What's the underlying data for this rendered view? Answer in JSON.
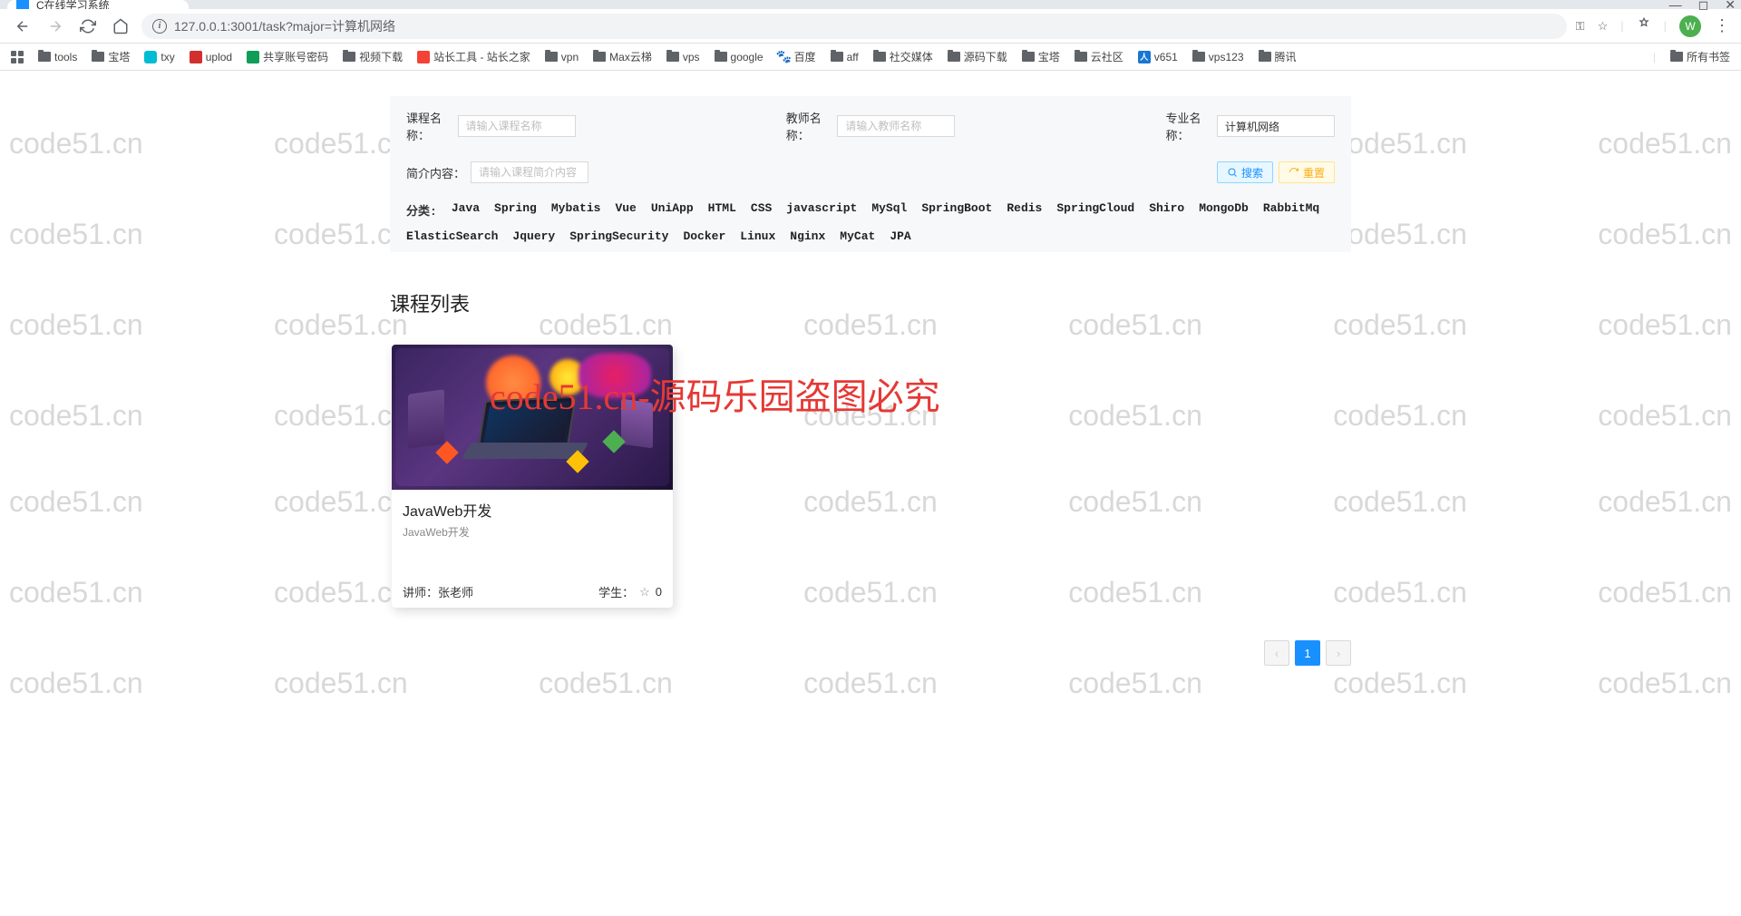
{
  "window": {
    "tab_title": "C在线学习系统"
  },
  "url_bar": {
    "url": "127.0.0.1:3001/task?major=计算机网络"
  },
  "avatar_letter": "W",
  "bookmarks": {
    "items": [
      {
        "label": "tools",
        "icon": "folder"
      },
      {
        "label": "宝塔",
        "icon": "folder"
      },
      {
        "label": "txy",
        "icon": "txy"
      },
      {
        "label": "uplod",
        "icon": "uplod"
      },
      {
        "label": "共享账号密码",
        "icon": "sheets"
      },
      {
        "label": "视频下载",
        "icon": "folder"
      },
      {
        "label": "站长工具 - 站长之家",
        "icon": "zz"
      },
      {
        "label": "vpn",
        "icon": "folder"
      },
      {
        "label": "Max云梯",
        "icon": "folder"
      },
      {
        "label": "vps",
        "icon": "folder"
      },
      {
        "label": "google",
        "icon": "folder"
      },
      {
        "label": "百度",
        "icon": "baidu"
      },
      {
        "label": "aff",
        "icon": "folder"
      },
      {
        "label": "社交媒体",
        "icon": "folder"
      },
      {
        "label": "源码下载",
        "icon": "folder"
      },
      {
        "label": "宝塔",
        "icon": "folder"
      },
      {
        "label": "云社区",
        "icon": "folder"
      },
      {
        "label": "v651",
        "icon": "v651"
      },
      {
        "label": "vps123",
        "icon": "folder"
      },
      {
        "label": "腾讯",
        "icon": "folder"
      }
    ],
    "all_bookmarks": "所有书签"
  },
  "search": {
    "course_label": "课程名称：",
    "course_placeholder": "请输入课程名称",
    "teacher_label": "教师名称：",
    "teacher_placeholder": "请输入教师名称",
    "major_label": "专业名称：",
    "major_value": "计算机网络",
    "intro_label": "简介内容：",
    "intro_placeholder": "请输入课程简介内容",
    "btn_search": "搜索",
    "btn_reset": "重置"
  },
  "categories": {
    "label": "分类:",
    "items": [
      "Java",
      "Spring",
      "Mybatis",
      "Vue",
      "UniApp",
      "HTML",
      "CSS",
      "javascript",
      "MySql",
      "SpringBoot",
      "Redis",
      "SpringCloud",
      "Shiro",
      "MongoDb",
      "RabbitMq",
      "ElasticSearch",
      "Jquery",
      "SpringSecurity",
      "Docker",
      "Linux",
      "Nginx",
      "MyCat",
      "JPA"
    ]
  },
  "list_title": "课程列表",
  "card": {
    "title": "JavaWeb开发",
    "subtitle": "JavaWeb开发",
    "teacher_label": "讲师：",
    "teacher_name": "张老师",
    "student_label": "学生：",
    "student_count": "0"
  },
  "pagination": {
    "current": "1"
  },
  "watermark_text": "code51.cn",
  "center_watermark": "code51.cn-源码乐园盗图必究"
}
